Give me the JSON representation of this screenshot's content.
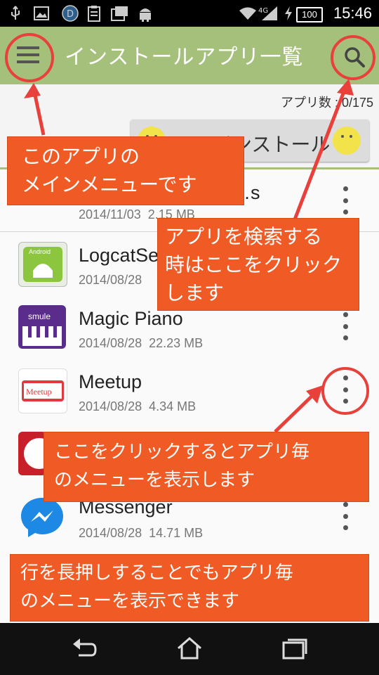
{
  "status_bar": {
    "time": "15:46",
    "battery": "100",
    "network": "4G",
    "icons": [
      "usb-icon",
      "image-icon",
      "dolphin-icon",
      "clipboard-icon",
      "gallery-icon",
      "android-icon",
      "wifi-icon",
      "signal-icon",
      "charging-icon"
    ]
  },
  "action_bar": {
    "title": "インストールアプリ一覧",
    "menu_icon": "hamburger-icon",
    "search_icon": "search-icon"
  },
  "app_count": "アプリ数 : 0/175",
  "uninstall_button": {
    "label": "アンインストール"
  },
  "apps": [
    {
      "name": "…s",
      "date": "2014/11/03",
      "size": "2.15 MB"
    },
    {
      "name": "LogcatSe",
      "date": "2014/08/28",
      "size": ""
    },
    {
      "name": "Magic Piano",
      "date": "2014/08/28",
      "size": "22.23 MB"
    },
    {
      "name": "Meetup",
      "date": "2014/08/28",
      "size": "4.34 MB"
    },
    {
      "name": "",
      "date": "",
      "size": ""
    },
    {
      "name": "Messenger",
      "date": "2014/08/28",
      "size": "14.71 MB"
    }
  ],
  "callouts": {
    "menu": [
      "このアプリの",
      "メインメニューです"
    ],
    "search": [
      "アプリを検索する",
      "時はここをクリック",
      "します"
    ],
    "row_menu": [
      "ここをクリックするとアプリ毎",
      "のメニューを表示します"
    ],
    "long_press": [
      "行を長押しすることでもアプリ毎",
      "のメニューを表示できます"
    ]
  },
  "colors": {
    "action_bar": "#a5c07a",
    "callout": "#f05a24",
    "annotation_circle": "#e8413b"
  },
  "nav_bar": {
    "back": "back-icon",
    "home": "home-icon",
    "recents": "recents-icon"
  }
}
